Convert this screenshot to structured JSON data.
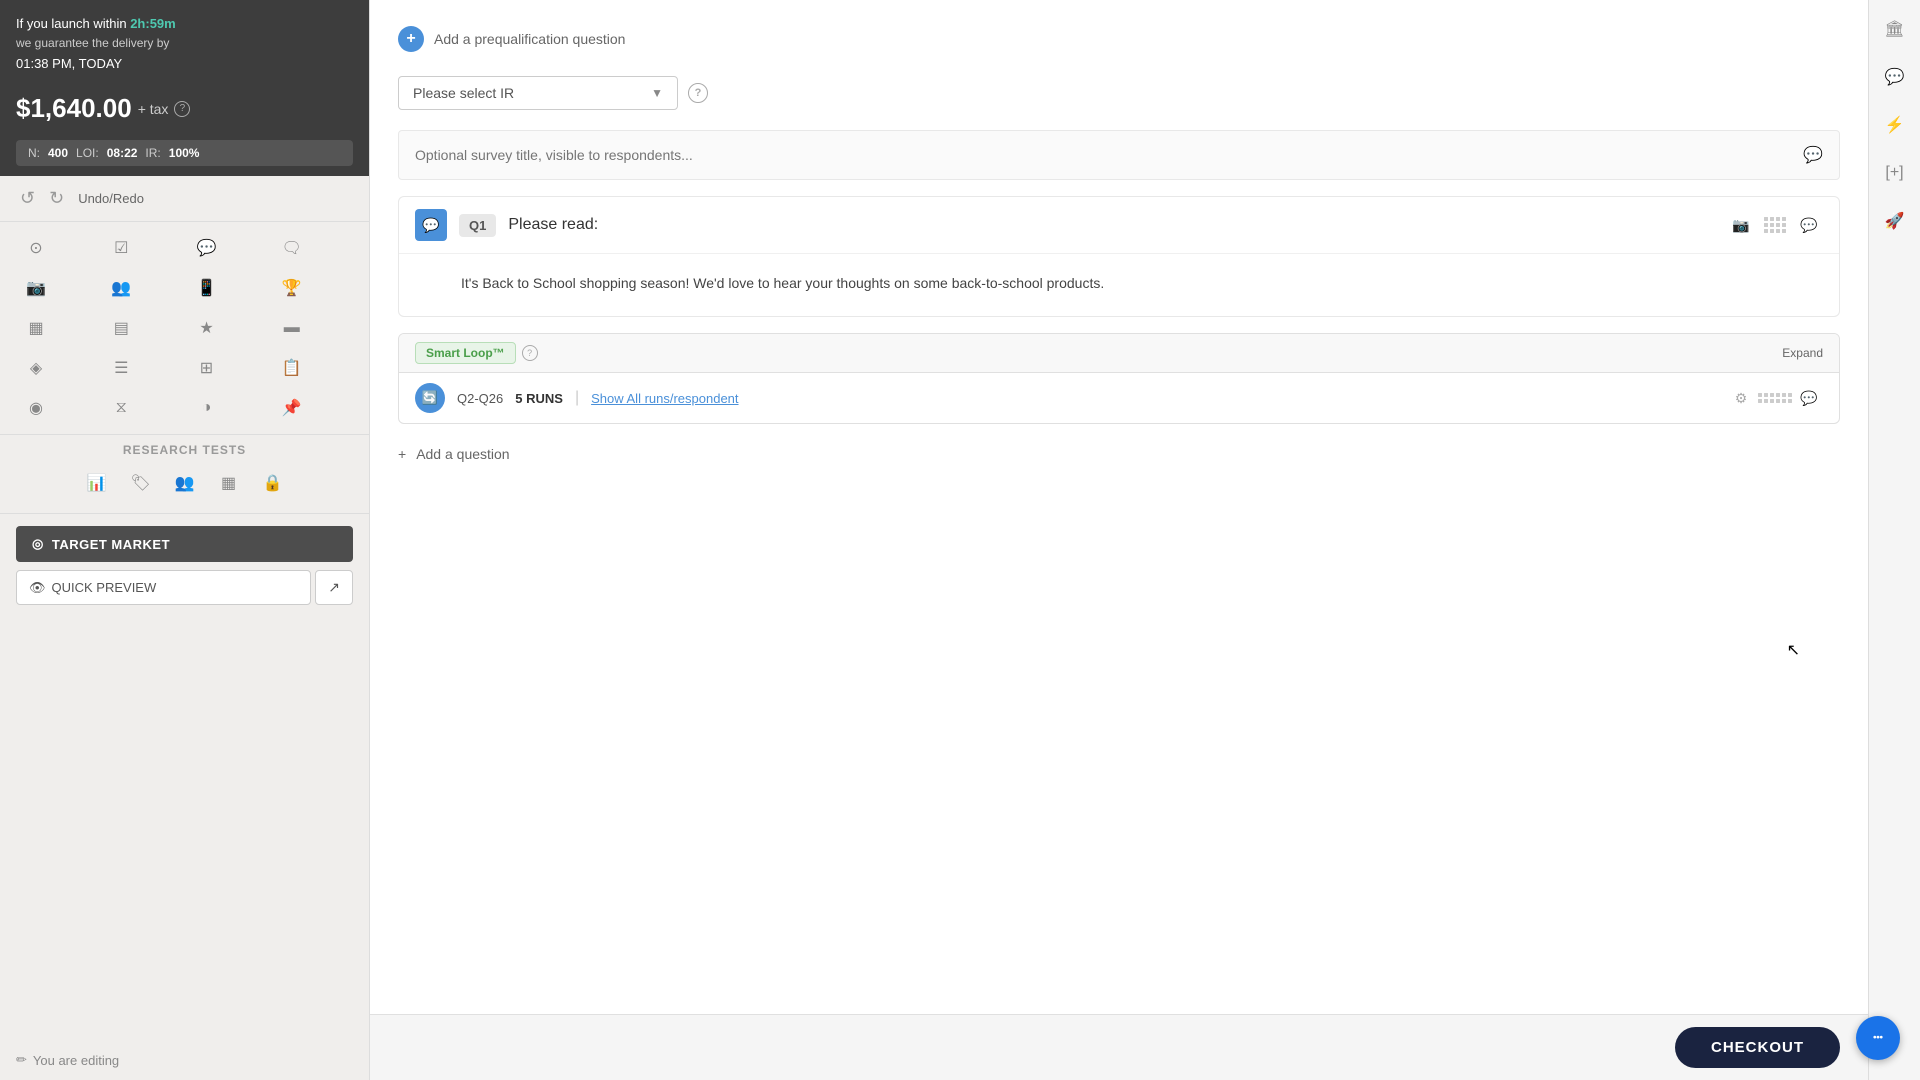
{
  "sidebar": {
    "launch_message": "If you launch within",
    "timer": "2h:59m",
    "guarantee_message": "we guarantee the delivery by",
    "delivery_time": "01:38 PM, TODAY",
    "price": "$1,640",
    "price_decimal": ".00",
    "price_suffix": "+ tax",
    "stats": {
      "n_label": "N:",
      "n_value": "400",
      "loi_label": "LOI:",
      "loi_value": "08:22",
      "ir_label": "IR:",
      "ir_value": "100%"
    },
    "undo_redo_label": "Undo/Redo",
    "research_tests_label": "RESEARCH TESTS",
    "target_market_label": "TARGET MARKET",
    "quick_preview_label": "QUICK PREVIEW",
    "you_are_editing_label": "You are editing"
  },
  "ir_dropdown": {
    "placeholder": "Please select IR",
    "help_tooltip": "?"
  },
  "survey": {
    "title_placeholder": "Optional survey title, visible to respondents...",
    "q1": {
      "label": "Q1",
      "title": "Please read:",
      "body": "It's Back to School shopping season! We'd love to hear your thoughts on some back-to-school products."
    },
    "smart_loop": {
      "badge": "Smart Loop™",
      "expand_label": "Expand",
      "range": "Q2-Q26",
      "runs_count": "5 RUNS",
      "divider": "|",
      "show_all_label": "Show All runs/respondent"
    },
    "add_question_label": "Add a question",
    "add_prequal_label": "Add a prequalification question"
  },
  "bottom_bar": {
    "checkout_label": "CHECKOUT"
  },
  "toolbar_icons": [
    "⊙",
    "☑",
    "💬",
    "🗨",
    "📷",
    "👥",
    "📱",
    "🏆",
    "▦",
    "▤",
    "★",
    "▬",
    "◈",
    "☰",
    "⊞",
    "📋",
    "◉",
    "⧖",
    "◑",
    "📌"
  ],
  "research_icons": [
    "📊",
    "🏷",
    "👥",
    "▦",
    "🔒"
  ],
  "right_panel_icons": [
    "🏛",
    "💬",
    "⚡",
    "[+]",
    "🚀"
  ]
}
